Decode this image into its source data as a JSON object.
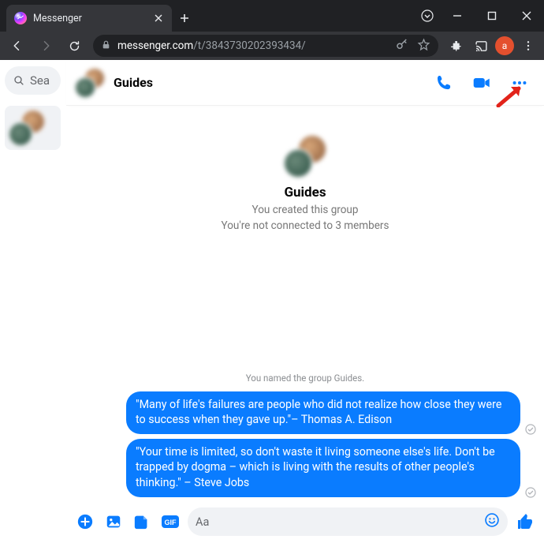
{
  "browser": {
    "tab_title": "Messenger",
    "url_host": "messenger.com",
    "url_path": "/t/3843730202393434/",
    "profile_initial": "a"
  },
  "sidebar": {
    "search_placeholder": "Sea"
  },
  "header": {
    "title": "Guides"
  },
  "hero": {
    "title": "Guides",
    "created": "You created this group",
    "connection": "You're not connected to 3 members"
  },
  "system": {
    "named": "You named the group Guides."
  },
  "messages": [
    {
      "text": "\"Many of life's failures are people who did not realize how close they were to success when they gave up.\"– Thomas A. Edison"
    },
    {
      "text": "\"Your time is limited, so don't waste it living someone else's life. Don't be trapped by dogma – which is living with the results of other people's thinking.\" – Steve Jobs"
    }
  ],
  "composer": {
    "placeholder": "Aa"
  }
}
